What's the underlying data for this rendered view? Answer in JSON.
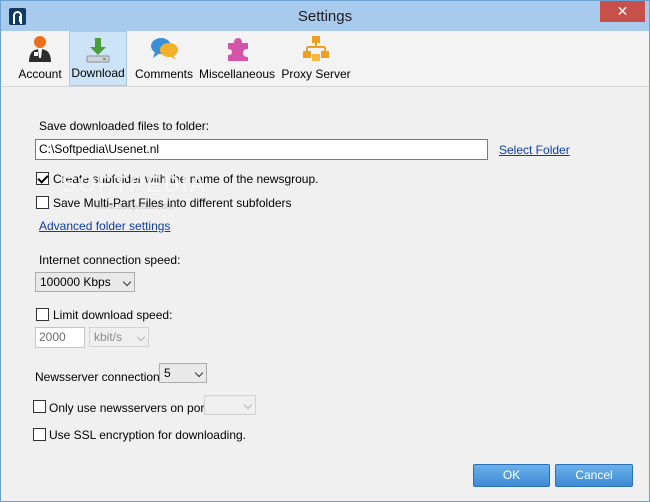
{
  "window": {
    "title": "Settings",
    "close_label": "✕"
  },
  "tabs": [
    {
      "label": "Account"
    },
    {
      "label": "Download"
    },
    {
      "label": "Comments"
    },
    {
      "label": "Miscellaneous"
    },
    {
      "label": "Proxy Server"
    }
  ],
  "active_tab": "Download",
  "download": {
    "save_folder_label": "Save downloaded files to folder:",
    "save_folder_value": "C:\\Softpedia\\Usenet.nl",
    "select_folder_link": "Select Folder",
    "create_subfolder_label": "Create subfolder with the name of the newsgroup.",
    "create_subfolder_checked": true,
    "multipart_label": "Save Multi-Part Files into different subfolders",
    "multipart_checked": false,
    "advanced_link": "Advanced folder settings",
    "speed_label": "Internet connection speed:",
    "speed_value": "100000 Kbps",
    "limit_label": "Limit download speed:",
    "limit_checked": false,
    "limit_value": "2000",
    "limit_unit": "kbit/s",
    "connections_label": "Newsserver connections:",
    "connections_value": "5",
    "port_label": "Only use newsservers on port:",
    "port_checked": false,
    "ssl_label": "Use SSL encryption for downloading.",
    "ssl_checked": false
  },
  "watermark": {
    "brand": "SOFTPEDIA",
    "url": "www.softpedia.com"
  },
  "buttons": {
    "ok": "OK",
    "cancel": "Cancel"
  }
}
